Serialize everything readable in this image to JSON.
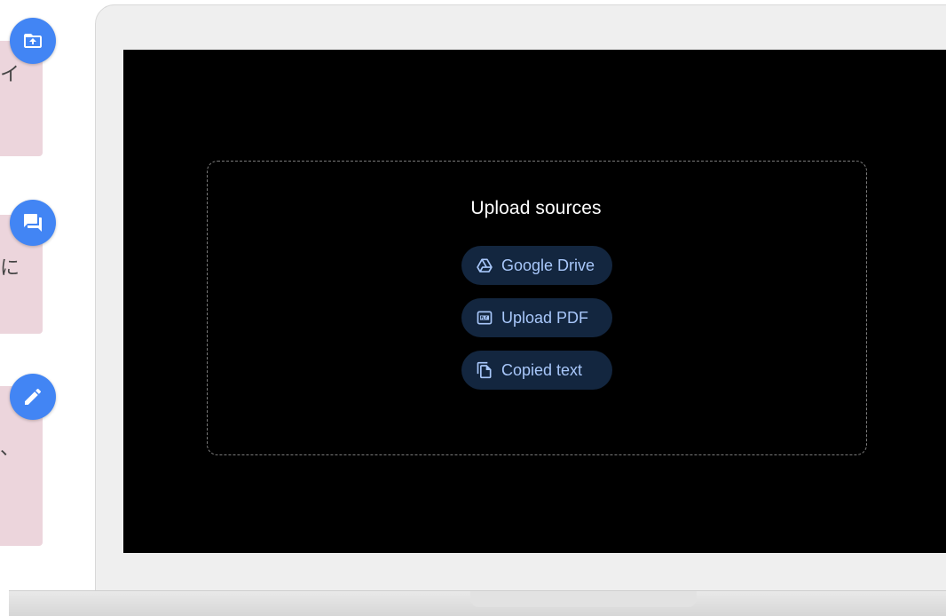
{
  "side_cards": [
    {
      "snippet": "イ",
      "icon": "upload-folder-icon"
    },
    {
      "snippet": "に",
      "icon": "chat-icon"
    },
    {
      "snippet": "、",
      "icon": "pencil-icon"
    }
  ],
  "upload": {
    "title": "Upload sources",
    "buttons": [
      {
        "label": "Google Drive",
        "icon": "google-drive-icon"
      },
      {
        "label": "Upload PDF",
        "icon": "pdf-icon"
      },
      {
        "label": "Copied text",
        "icon": "copy-icon"
      }
    ]
  },
  "colors": {
    "accent": "#4285f4",
    "card_bg": "#ecd5dc",
    "screen_bg": "#000000",
    "button_bg": "#13263f",
    "button_text": "#a8c7fa"
  }
}
